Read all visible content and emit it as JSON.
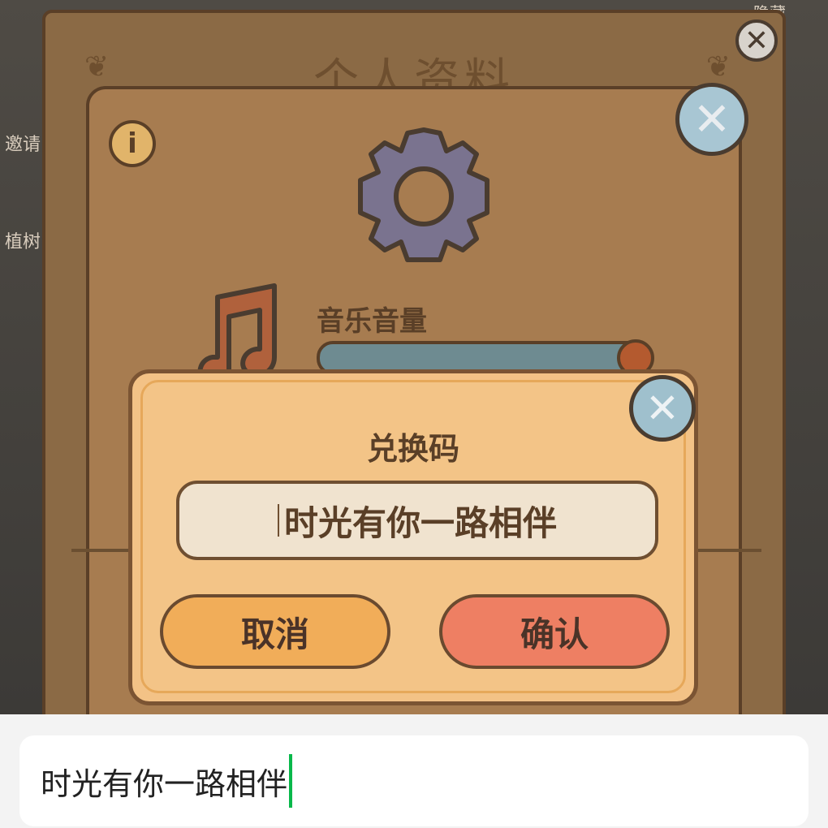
{
  "background": {
    "side_labels": [
      "邀请",
      "植树"
    ],
    "top_right_label": "隐藏"
  },
  "profile_panel": {
    "title": "个人资料",
    "close_icon": "close-icon",
    "ornaments": [
      "ornament-left",
      "ornament-right"
    ]
  },
  "settings_panel": {
    "info_icon": "info-icon",
    "close_icon": "close-icon",
    "gear_icon": "gear-icon",
    "music_icon": "music-note-icon",
    "music_label": "音乐音量",
    "music_volume": 1.0
  },
  "redeem_dialog": {
    "title": "兑换码",
    "input_value": "时光有你一路相伴",
    "cancel_label": "取消",
    "confirm_label": "确认",
    "close_icon": "close-icon"
  },
  "ime": {
    "input_value": "时光有你一路相伴"
  }
}
